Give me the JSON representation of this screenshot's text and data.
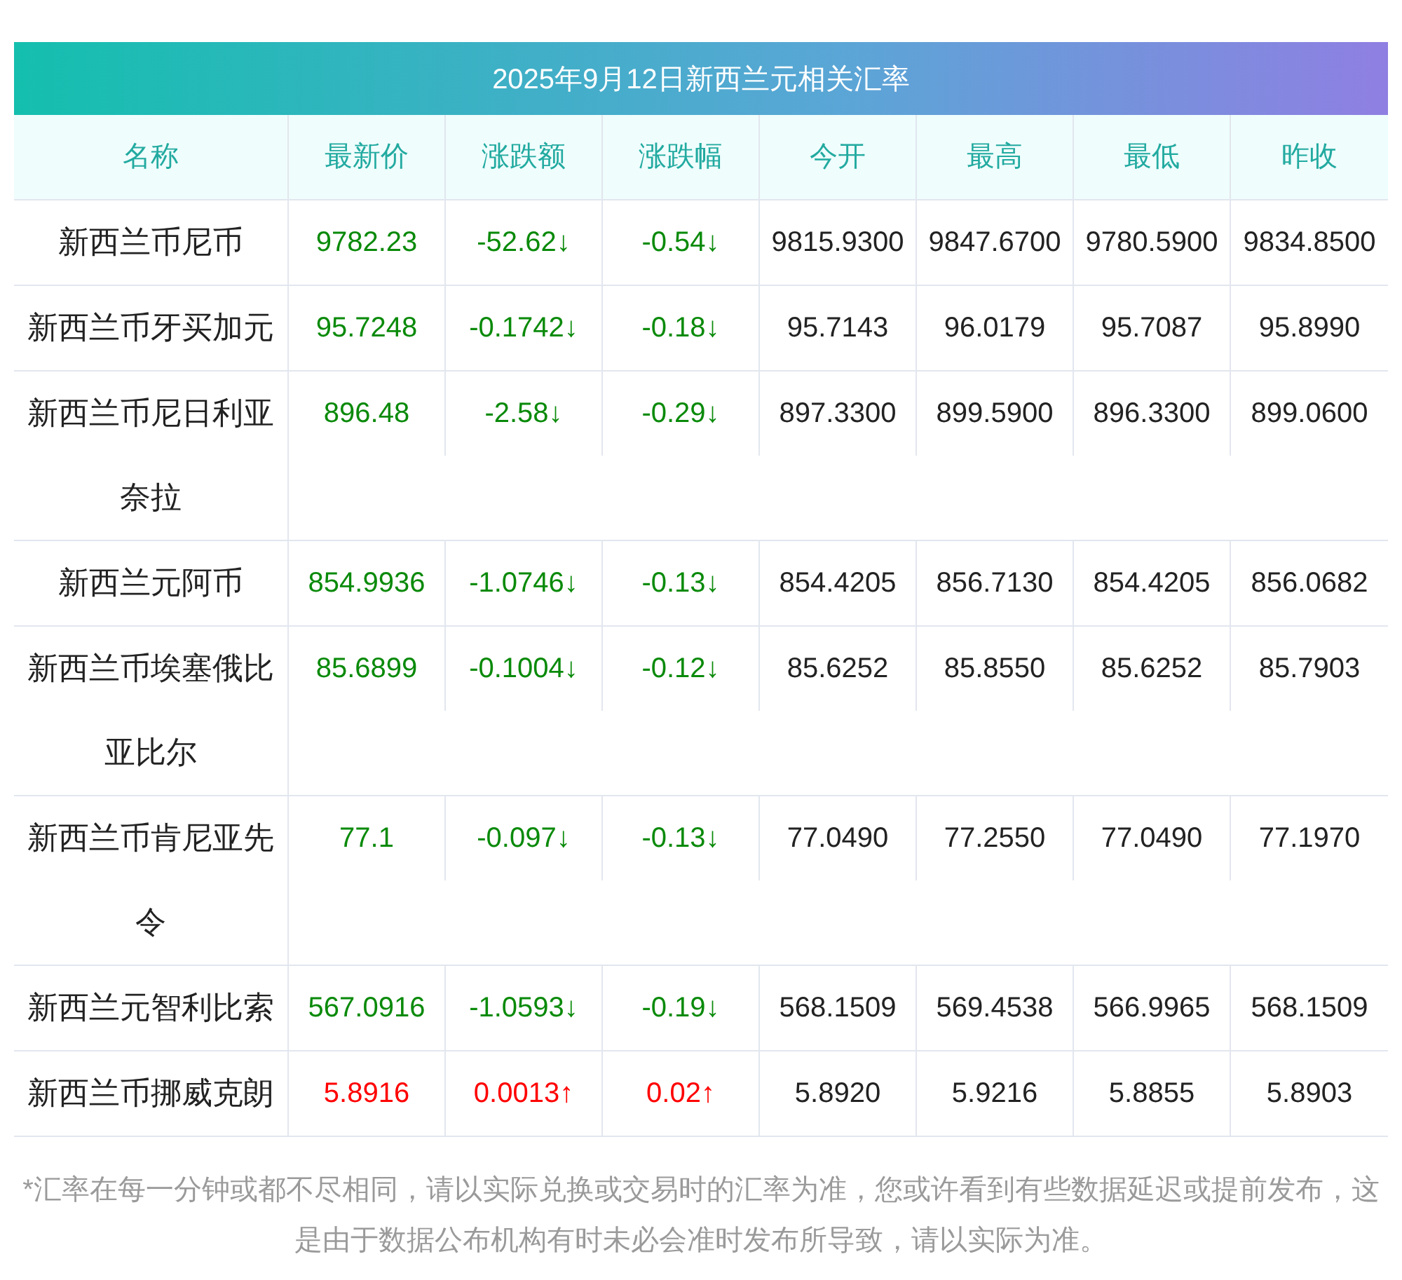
{
  "title": "2025年9月12日新西兰元相关汇率",
  "columns": [
    "名称",
    "最新价",
    "涨跌额",
    "涨跌幅",
    "今开",
    "最高",
    "最低",
    "昨收"
  ],
  "rows": [
    {
      "name": "新西兰币尼币",
      "color": "#0a8a0a",
      "price": "9782.23",
      "change": "-52.62↓",
      "percent": "-0.54↓",
      "open": "9815.9300",
      "high": "9847.6700",
      "low": "9780.5900",
      "prev": "9834.8500"
    },
    {
      "name": "新西兰币牙买加元",
      "color": "#0a8a0a",
      "price": "95.7248",
      "change": "-0.1742↓",
      "percent": "-0.18↓",
      "open": "95.7143",
      "high": "96.0179",
      "low": "95.7087",
      "prev": "95.8990"
    },
    {
      "name": "新西兰币尼日利亚奈拉",
      "color": "#0a8a0a",
      "price": "896.48",
      "change": "-2.58↓",
      "percent": "-0.29↓",
      "open": "897.3300",
      "high": "899.5900",
      "low": "896.3300",
      "prev": "899.0600"
    },
    {
      "name": "新西兰元阿币",
      "color": "#0a8a0a",
      "price": "854.9936",
      "change": "-1.0746↓",
      "percent": "-0.13↓",
      "open": "854.4205",
      "high": "856.7130",
      "low": "854.4205",
      "prev": "856.0682"
    },
    {
      "name": "新西兰币埃塞俄比亚比尔",
      "color": "#0a8a0a",
      "price": "85.6899",
      "change": "-0.1004↓",
      "percent": "-0.12↓",
      "open": "85.6252",
      "high": "85.8550",
      "low": "85.6252",
      "prev": "85.7903"
    },
    {
      "name": "新西兰币肯尼亚先令",
      "color": "#0a8a0a",
      "price": "77.1",
      "change": "-0.097↓",
      "percent": "-0.13↓",
      "open": "77.0490",
      "high": "77.2550",
      "low": "77.0490",
      "prev": "77.1970"
    },
    {
      "name": "新西兰元智利比索",
      "color": "#0a8a0a",
      "price": "567.0916",
      "change": "-1.0593↓",
      "percent": "-0.19↓",
      "open": "568.1509",
      "high": "569.4538",
      "low": "566.9965",
      "prev": "568.1509"
    },
    {
      "name": "新西兰币挪威克朗",
      "color": "#ff0000",
      "price": "5.8916",
      "change": "0.0013↑",
      "percent": "0.02↑",
      "open": "5.8920",
      "high": "5.9216",
      "low": "5.8855",
      "prev": "5.8903"
    }
  ],
  "note": "*汇率在每一分钟或都不尽相同，请以实际兑换或交易时的汇率为准，您或许看到有些数据延迟或提前发布，这是由于数据公布机构有时未必会准时发布所导致，请以实际为准。"
}
